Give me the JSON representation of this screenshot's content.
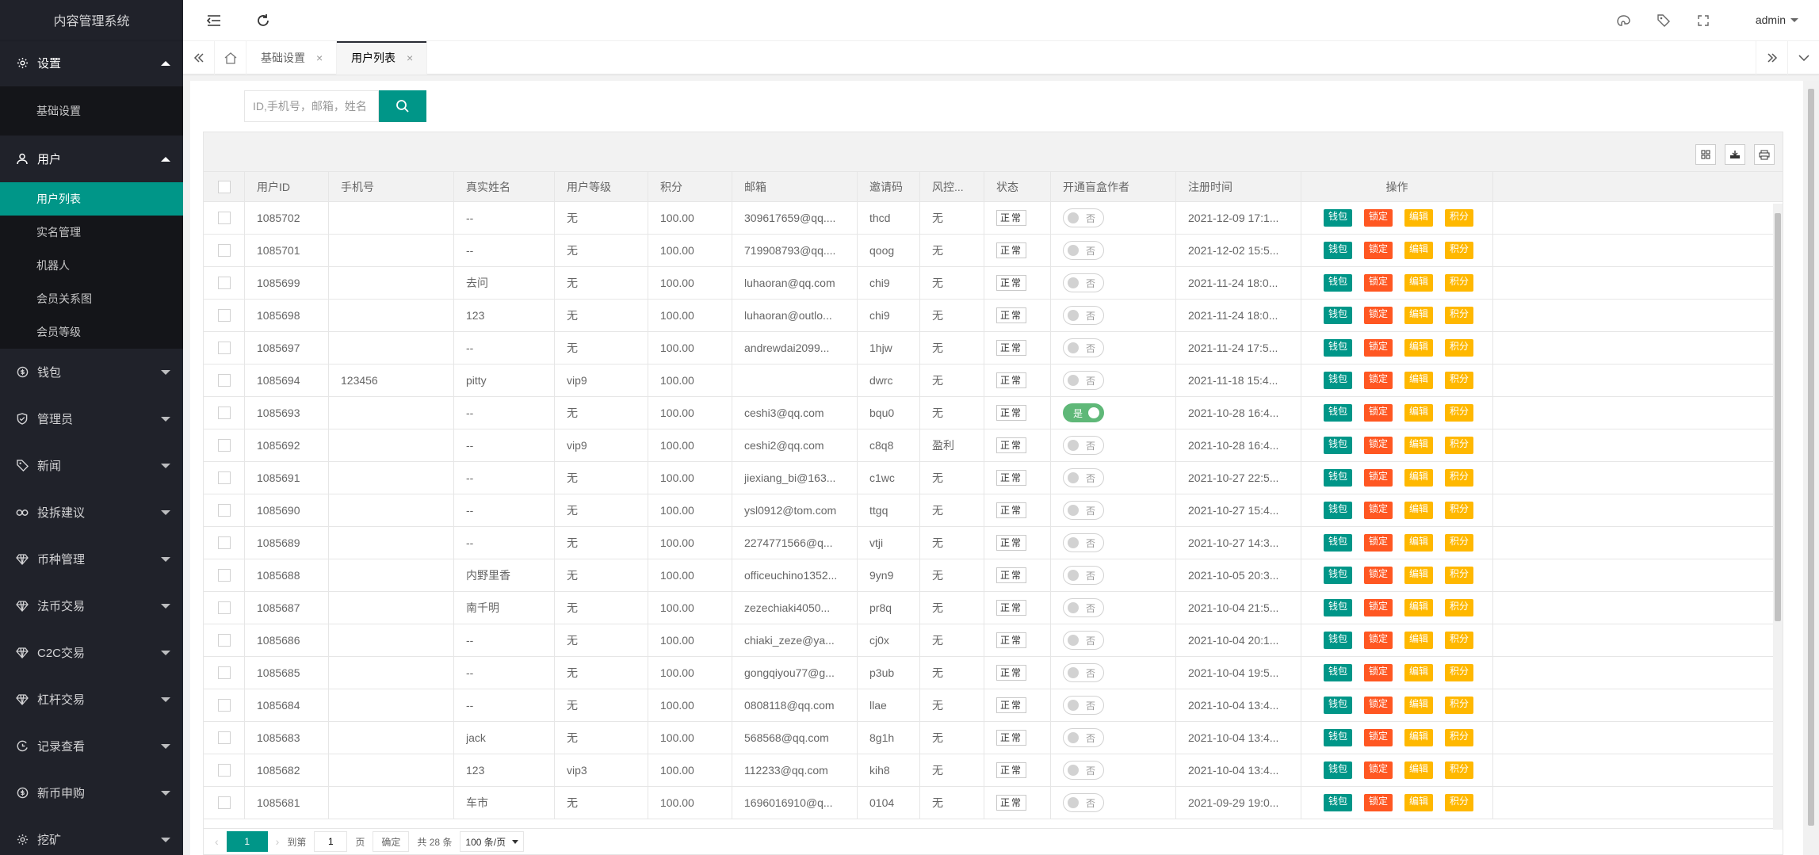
{
  "app": {
    "title": "内容管理系统"
  },
  "sidebar": {
    "groups": [
      {
        "label": "设置",
        "icon": "gear-icon",
        "open": true,
        "items": [
          "基础设置"
        ]
      },
      {
        "label": "用户",
        "icon": "user-icon",
        "open": true,
        "items": [
          "用户列表",
          "实名管理",
          "机器人",
          "会员关系图",
          "会员等级"
        ],
        "active_item": "用户列表"
      },
      {
        "label": "钱包",
        "icon": "coin-icon",
        "open": false
      },
      {
        "label": "管理员",
        "icon": "shield-icon",
        "open": false
      },
      {
        "label": "新闻",
        "icon": "tag-icon",
        "open": false
      },
      {
        "label": "投拆建议",
        "icon": "link-icon",
        "open": false
      },
      {
        "label": "币种管理",
        "icon": "diamond-icon",
        "open": false
      },
      {
        "label": "法币交易",
        "icon": "diamond-icon",
        "open": false
      },
      {
        "label": "C2C交易",
        "icon": "diamond-icon",
        "open": false
      },
      {
        "label": "杠杆交易",
        "icon": "diamond-icon",
        "open": false
      },
      {
        "label": "记录查看",
        "icon": "record-icon",
        "open": false
      },
      {
        "label": "新币申购",
        "icon": "coin-icon",
        "open": false
      },
      {
        "label": "挖矿",
        "icon": "gear-icon",
        "open": false
      }
    ]
  },
  "header": {
    "user": "admin"
  },
  "tabs": {
    "items": [
      "基础设置",
      "用户列表"
    ],
    "active": "用户列表"
  },
  "search": {
    "placeholder": "ID,手机号，邮箱，姓名"
  },
  "table": {
    "columns": [
      "用户ID",
      "手机号",
      "真实姓名",
      "用户等级",
      "积分",
      "邮箱",
      "邀请码",
      "风控...",
      "状态",
      "开通盲盒作者",
      "注册时间",
      "操作"
    ],
    "status_label": "正常",
    "switch_off": "否",
    "switch_on": "是",
    "ops": [
      "钱包",
      "锁定",
      "编辑",
      "积分"
    ],
    "colors": {
      "teal": "#009688",
      "red": "#ff5722",
      "yellow": "#ffb800",
      "switch_on": "#5fb878"
    },
    "rows": [
      {
        "id": "1085702",
        "phone": "",
        "name": "--",
        "level": "无",
        "points": "100.00",
        "email": "309617659@qq....",
        "code": "thcd",
        "risk": "无",
        "box": false,
        "time": "2021-12-09 17:1..."
      },
      {
        "id": "1085701",
        "phone": "",
        "name": "--",
        "level": "无",
        "points": "100.00",
        "email": "719908793@qq....",
        "code": "qoog",
        "risk": "无",
        "box": false,
        "time": "2021-12-02 15:5..."
      },
      {
        "id": "1085699",
        "phone": "",
        "name": "去问",
        "level": "无",
        "points": "100.00",
        "email": "luhaoran@qq.com",
        "code": "chi9",
        "risk": "无",
        "box": false,
        "time": "2021-11-24 18:0..."
      },
      {
        "id": "1085698",
        "phone": "",
        "name": "123",
        "level": "无",
        "points": "100.00",
        "email": "luhaoran@outlo...",
        "code": "chi9",
        "risk": "无",
        "box": false,
        "time": "2021-11-24 18:0..."
      },
      {
        "id": "1085697",
        "phone": "",
        "name": "--",
        "level": "无",
        "points": "100.00",
        "email": "andrewdai2099...",
        "code": "1hjw",
        "risk": "无",
        "box": false,
        "time": "2021-11-24 17:5..."
      },
      {
        "id": "1085694",
        "phone": "123456",
        "name": "pitty",
        "level": "vip9",
        "points": "100.00",
        "email": "",
        "code": "dwrc",
        "risk": "无",
        "box": false,
        "time": "2021-11-18 15:4..."
      },
      {
        "id": "1085693",
        "phone": "",
        "name": "--",
        "level": "无",
        "points": "100.00",
        "email": "ceshi3@qq.com",
        "code": "bqu0",
        "risk": "无",
        "box": true,
        "time": "2021-10-28 16:4..."
      },
      {
        "id": "1085692",
        "phone": "",
        "name": "--",
        "level": "vip9",
        "points": "100.00",
        "email": "ceshi2@qq.com",
        "code": "c8q8",
        "risk": "盈利",
        "box": false,
        "time": "2021-10-28 16:4..."
      },
      {
        "id": "1085691",
        "phone": "",
        "name": "--",
        "level": "无",
        "points": "100.00",
        "email": "jiexiang_bi@163...",
        "code": "c1wc",
        "risk": "无",
        "box": false,
        "time": "2021-10-27 22:5..."
      },
      {
        "id": "1085690",
        "phone": "",
        "name": "--",
        "level": "无",
        "points": "100.00",
        "email": "ysl0912@tom.com",
        "code": "ttgq",
        "risk": "无",
        "box": false,
        "time": "2021-10-27 15:4..."
      },
      {
        "id": "1085689",
        "phone": "",
        "name": "--",
        "level": "无",
        "points": "100.00",
        "email": "2274771566@q...",
        "code": "vtji",
        "risk": "无",
        "box": false,
        "time": "2021-10-27 14:3..."
      },
      {
        "id": "1085688",
        "phone": "",
        "name": "内野里香",
        "level": "无",
        "points": "100.00",
        "email": "officeuchino1352...",
        "code": "9yn9",
        "risk": "无",
        "box": false,
        "time": "2021-10-05 20:3..."
      },
      {
        "id": "1085687",
        "phone": "",
        "name": "南千明",
        "level": "无",
        "points": "100.00",
        "email": "zezechiaki4050...",
        "code": "pr8q",
        "risk": "无",
        "box": false,
        "time": "2021-10-04 21:5..."
      },
      {
        "id": "1085686",
        "phone": "",
        "name": "--",
        "level": "无",
        "points": "100.00",
        "email": "chiaki_zeze@ya...",
        "code": "cj0x",
        "risk": "无",
        "box": false,
        "time": "2021-10-04 20:1..."
      },
      {
        "id": "1085685",
        "phone": "",
        "name": "--",
        "level": "无",
        "points": "100.00",
        "email": "gongqiyou77@g...",
        "code": "p3ub",
        "risk": "无",
        "box": false,
        "time": "2021-10-04 19:5..."
      },
      {
        "id": "1085684",
        "phone": "",
        "name": "--",
        "level": "无",
        "points": "100.00",
        "email": "0808118@qq.com",
        "code": "llae",
        "risk": "无",
        "box": false,
        "time": "2021-10-04 13:4..."
      },
      {
        "id": "1085683",
        "phone": "",
        "name": "jack",
        "level": "无",
        "points": "100.00",
        "email": "568568@qq.com",
        "code": "8g1h",
        "risk": "无",
        "box": false,
        "time": "2021-10-04 13:4..."
      },
      {
        "id": "1085682",
        "phone": "",
        "name": "123",
        "level": "vip3",
        "points": "100.00",
        "email": "112233@qq.com",
        "code": "kih8",
        "risk": "无",
        "box": false,
        "time": "2021-10-04 13:4..."
      },
      {
        "id": "1085681",
        "phone": "",
        "name": "车市",
        "level": "无",
        "points": "100.00",
        "email": "1696016910@q...",
        "code": "0104",
        "risk": "无",
        "box": false,
        "time": "2021-09-29 19:0..."
      }
    ]
  },
  "pager": {
    "page": "1",
    "goto_label": "到第",
    "page_unit": "页",
    "confirm": "确定",
    "total": "共 28 条",
    "page_size": "100 条/页"
  }
}
